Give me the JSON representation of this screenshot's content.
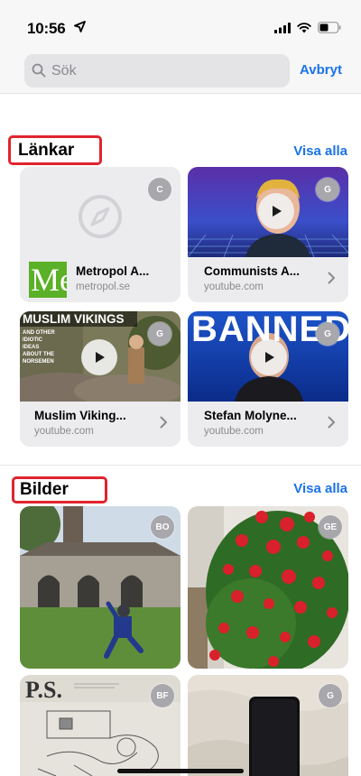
{
  "status_bar": {
    "time": "10:56"
  },
  "search": {
    "placeholder": "Sök",
    "cancel_label": "Avbryt"
  },
  "links_section": {
    "title": "Länkar",
    "see_all_label": "Visa alla",
    "items": [
      {
        "title": "Metropol A...",
        "domain": "metropol.se",
        "avatar": "C",
        "logo_text": "Me"
      },
      {
        "title": "Communists A...",
        "domain": "youtube.com",
        "avatar": "G"
      },
      {
        "title": "Muslim Viking...",
        "domain": "youtube.com",
        "avatar": "G",
        "thumb_title": "MUSLIM VIKINGS",
        "thumb_sub": [
          "AND OTHER",
          "IDIOTIC",
          "IDEAS",
          "ABOUT THE",
          "NORSEMEN"
        ]
      },
      {
        "title": "Stefan Molyne...",
        "domain": "youtube.com",
        "avatar": "G",
        "thumb_title": "BANNED"
      }
    ]
  },
  "photos_section": {
    "title": "Bilder",
    "see_all_label": "Visa alla",
    "items": [
      {
        "avatar": "BO"
      },
      {
        "avatar": "GE"
      },
      {
        "avatar": "BF",
        "thumb_text": "P.S."
      },
      {
        "avatar": "G"
      }
    ]
  },
  "colors": {
    "accent": "#1a73e8",
    "highlight": "#e0242f"
  }
}
